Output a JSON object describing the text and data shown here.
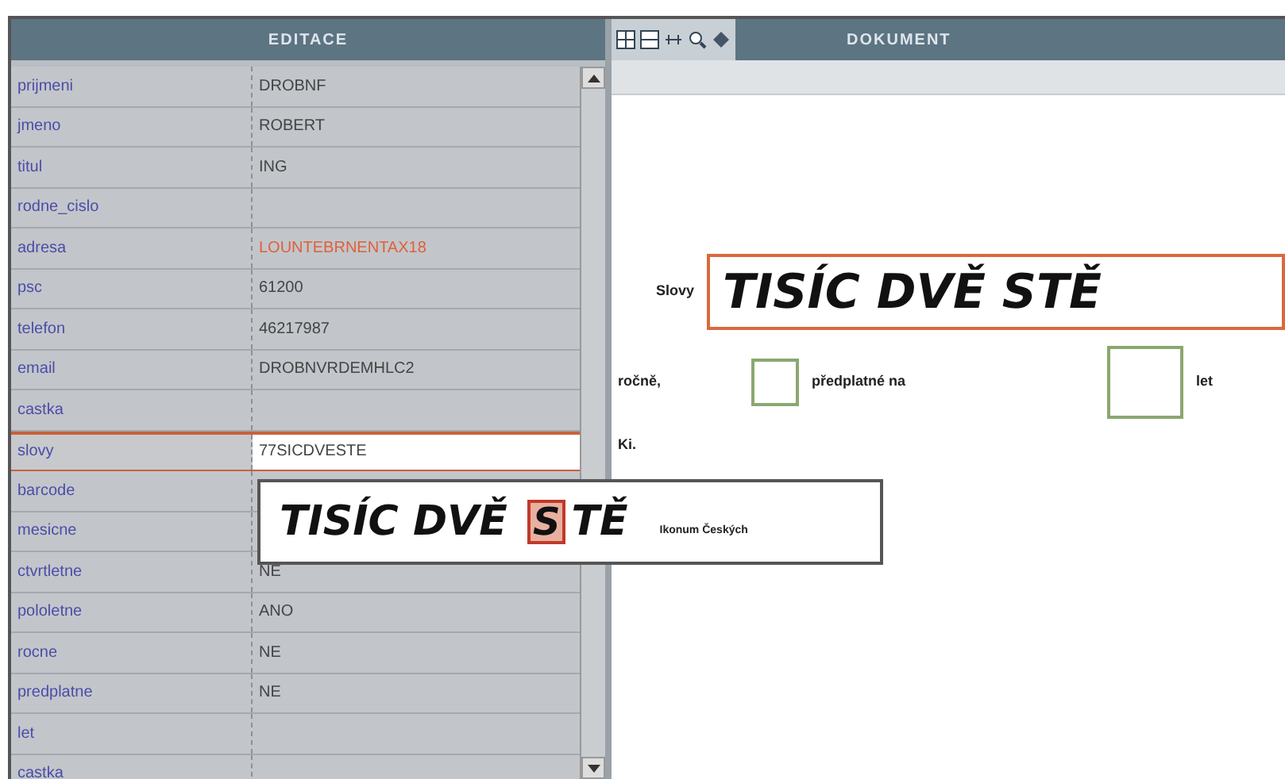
{
  "editor": {
    "title": "EDITACE",
    "rows": [
      {
        "label": "prijmeni",
        "value": "DROBNF",
        "selected": false,
        "kind": "normal"
      },
      {
        "label": "jmeno",
        "value": "ROBERT",
        "selected": false,
        "kind": "normal"
      },
      {
        "label": "titul",
        "value": "ING",
        "selected": false,
        "kind": "normal"
      },
      {
        "label": "rodne_cislo",
        "selected": false
      },
      {
        "label": "adresa",
        "value": "LOUNTEBRNENTAX18",
        "selected": false,
        "kind": "error"
      },
      {
        "label": "psc",
        "value": "61200",
        "selected": false,
        "kind": "normal"
      },
      {
        "label": "telefon",
        "value": "46217987",
        "selected": false,
        "kind": "normal"
      },
      {
        "label": "email",
        "value": "DROBNVRDEMHLC2",
        "selected": false,
        "kind": "normal"
      },
      {
        "label": "castka",
        "selected": false
      },
      {
        "label": "slovy",
        "value": "77SICDVESTE",
        "selected": true,
        "kind": "normal"
      },
      {
        "label": "barcode",
        "selected": false
      },
      {
        "label": "mesicne",
        "selected": false
      },
      {
        "label": "ctvrtletne",
        "value": "NE",
        "selected": false,
        "kind": "normal"
      },
      {
        "label": "pololetne",
        "value": "ANO",
        "selected": false,
        "kind": "normal"
      },
      {
        "label": "rocne",
        "value": "NE",
        "selected": false,
        "kind": "normal"
      },
      {
        "label": "predplatne",
        "value": "NE",
        "selected": false,
        "kind": "normal"
      },
      {
        "label": "let",
        "selected": false
      },
      {
        "label": "castka",
        "selected": false
      }
    ],
    "popup": {
      "before": "TISÍC DVĚ ",
      "highlight": "S",
      "after": "TĚ",
      "caption": "Ikonum Českých"
    }
  },
  "document": {
    "title": "DOKUMENT",
    "slovy_label": "Slovy",
    "slovy_value": "TISÍC DVĚ STĚ",
    "rocne_label": "ročně,",
    "predplatne_label": "předplatné na",
    "let_label": "let",
    "footer_text": "Ki."
  }
}
